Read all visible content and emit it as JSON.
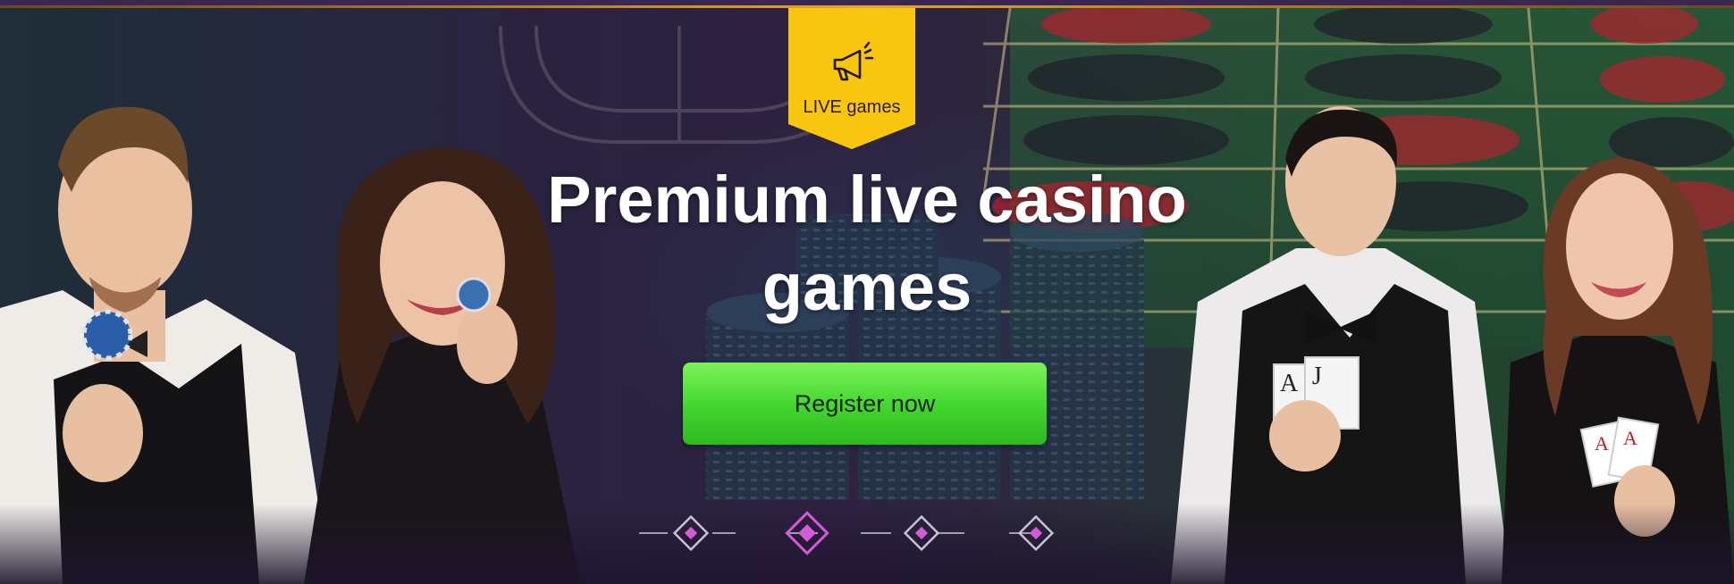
{
  "badge": {
    "label": "LIVE games",
    "icon": "megaphone-icon",
    "color": "#f8c60e"
  },
  "hero": {
    "headline_line1": "Premium live casino",
    "headline_line2": "games",
    "cta_label": "Register now"
  },
  "pager": {
    "count": 4,
    "active_index": 1
  },
  "colors": {
    "accent_gold": "#e3a52b",
    "cta_green": "#41d52d",
    "pager_pink": "#d45ad8"
  }
}
